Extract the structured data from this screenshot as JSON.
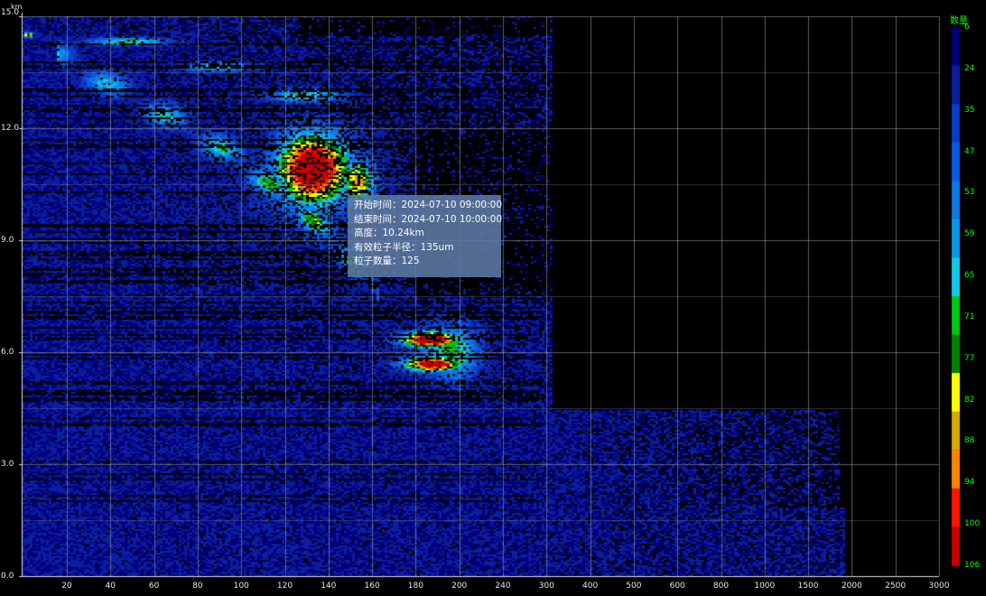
{
  "chart_data": {
    "type": "heatmap",
    "ylabel_unit": "km",
    "xlabel_unit": "",
    "y_ticks": [
      "15.0",
      "12.0",
      "9.0",
      "6.0",
      "3.0",
      "0.0"
    ],
    "ylim": [
      0,
      15
    ],
    "x_ticks": [
      "20",
      "40",
      "60",
      "80",
      "100",
      "120",
      "140",
      "160",
      "180",
      "200",
      "240",
      "300",
      "400",
      "500",
      "600",
      "800",
      "1000",
      "1500",
      "2000",
      "2500",
      "3000"
    ],
    "x_scale": "non-uniform",
    "grid": true,
    "legend": {
      "title": "数量",
      "placement": "right",
      "levels": [
        {
          "label": "6",
          "color": "#00007a"
        },
        {
          "label": "24",
          "color": "#0a1ea0"
        },
        {
          "label": "35",
          "color": "#0a3cc8"
        },
        {
          "label": "47",
          "color": "#0a5ae0"
        },
        {
          "label": "53",
          "color": "#0a78e6"
        },
        {
          "label": "59",
          "color": "#0a96e6"
        },
        {
          "label": "65",
          "color": "#14c8e6"
        },
        {
          "label": "71",
          "color": "#00c814"
        },
        {
          "label": "77",
          "color": "#008200"
        },
        {
          "label": "82",
          "color": "#ffff00"
        },
        {
          "label": "88",
          "color": "#d2aa00"
        },
        {
          "label": "94",
          "color": "#ff8200"
        },
        {
          "label": "100",
          "color": "#ff1400"
        },
        {
          "label": "106",
          "color": "#c80000"
        }
      ]
    },
    "features": [
      {
        "x_range": [
          100,
          140
        ],
        "y_range": [
          9.8,
          11.9
        ],
        "level": 106
      },
      {
        "x_range": [
          160,
          185
        ],
        "y_range": [
          5.0,
          6.8
        ],
        "level": 106
      },
      {
        "x_range": [
          20,
          110
        ],
        "y_range": [
          12.6,
          14.5
        ],
        "level": 77
      },
      {
        "x_range": [
          0,
          600
        ],
        "y_range": [
          0,
          15
        ],
        "level": 6
      },
      {
        "x_range": [
          600,
          2000
        ],
        "y_range": [
          0,
          4.6
        ],
        "level": 6
      }
    ]
  },
  "tooltip": {
    "start_time": "开始时间：2024-07-10 09:00:00",
    "end_time": "结束时间：2024-07-10 10:00:00",
    "height": "高度：10.24km",
    "radius": "有效粒子半径：135um",
    "count": "粒子数量：125"
  }
}
